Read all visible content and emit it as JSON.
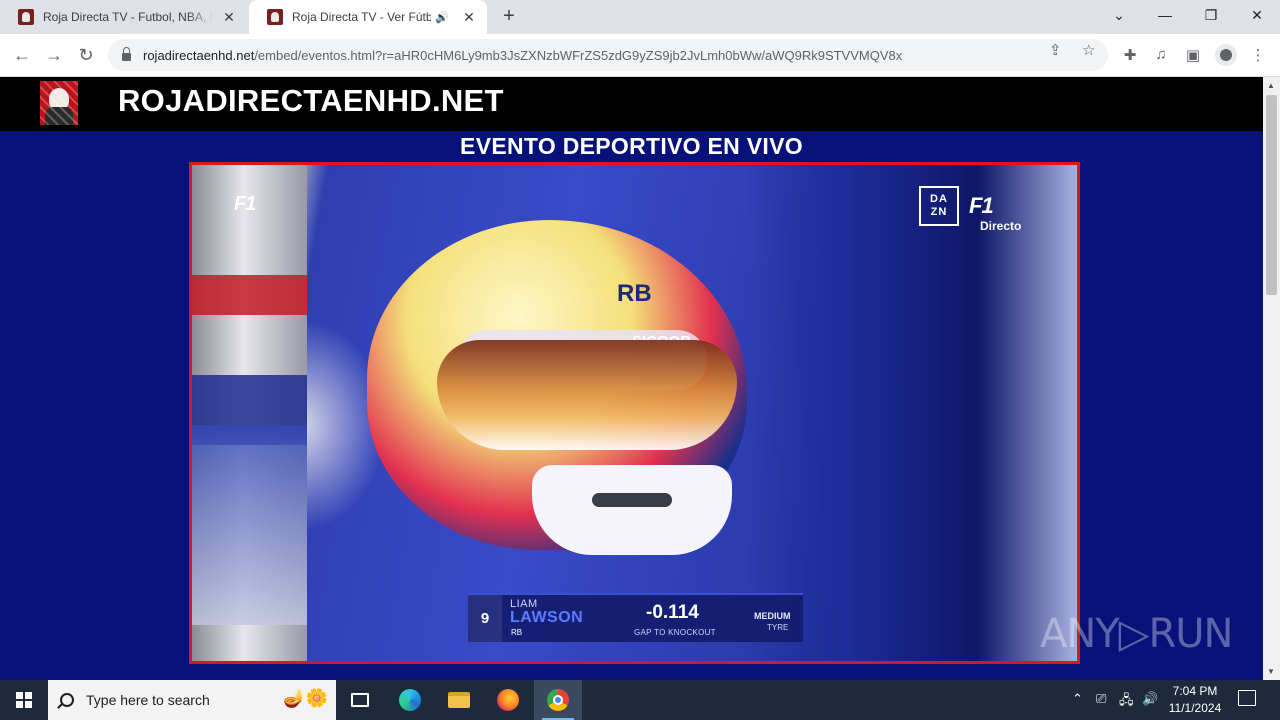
{
  "browser": {
    "tabs": [
      {
        "title": "Roja Directa TV - Futbol, NBA, M"
      },
      {
        "title": "Roja Directa TV - Ver Fútbol"
      }
    ],
    "url_host": "rojadirectaenhd.net",
    "url_path": "/embed/eventos.html?r=aHR0cHM6Ly9mb3JsZXNzbWFrZS5zdG9yZS9jb2JvLmh0bWw/aWQ9Rk9STVVMQV8x"
  },
  "site": {
    "name": "ROJADIRECTAENHD.NET",
    "heading": "EVENTO DEPORTIVO EN VIVO"
  },
  "video": {
    "broadcaster": "DAZN",
    "dazn_line1": "DA",
    "dazn_line2": "ZN",
    "f1_logo": "F1",
    "live_label": "Directo",
    "helmet_text_rb": "RB",
    "helmet_text_sponsor": "SICOOB",
    "lower_third": {
      "number": "9",
      "first_name": "LIAM",
      "last_name": "LAWSON",
      "team": "RB",
      "gap": "-0.114",
      "gap_label": "GAP TO KNOCKOUT",
      "tyre": "MEDIUM",
      "tyre_label": "TYRE"
    },
    "watermark": "ANY▷RUN"
  },
  "taskbar": {
    "search_placeholder": "Type here to search",
    "time": "7:04 PM",
    "date": "11/1/2024"
  }
}
